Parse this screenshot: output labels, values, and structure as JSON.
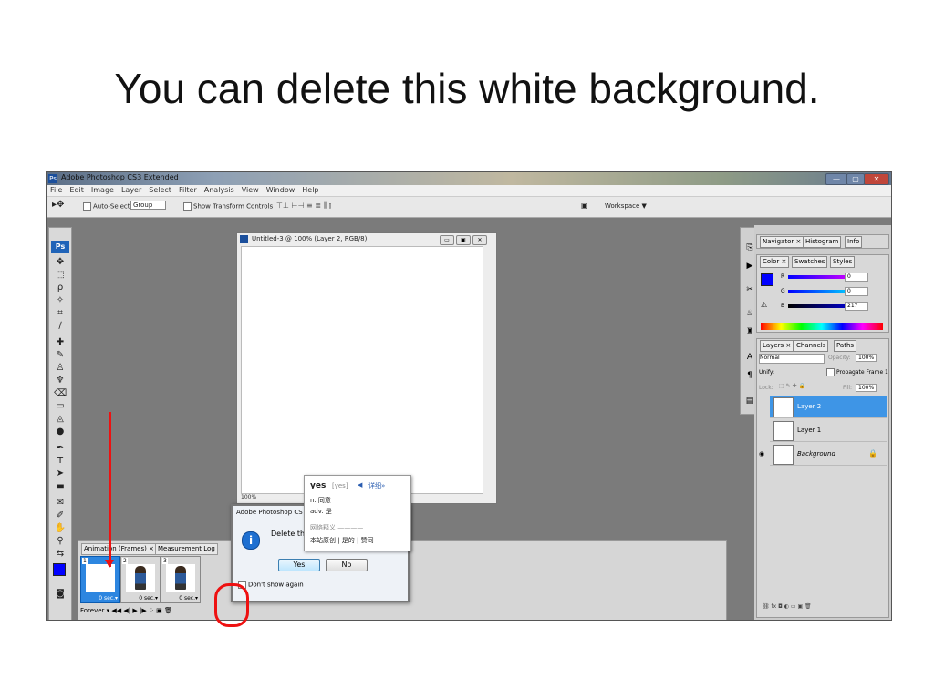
{
  "slide": {
    "title": "You can delete this white background."
  },
  "window": {
    "app_title": "Adobe Photoshop CS3 Extended",
    "app_icon": "Ps",
    "buttons": [
      "—",
      "▢",
      "✕"
    ]
  },
  "menu": [
    "File",
    "Edit",
    "Image",
    "Layer",
    "Select",
    "Filter",
    "Analysis",
    "View",
    "Window",
    "Help"
  ],
  "options": {
    "auto_select": "Auto-Select:",
    "group_value": "Group",
    "show_transform": "Show Transform Controls",
    "workspace": "Workspace ▼"
  },
  "toolbox": {
    "logo": "Ps"
  },
  "document": {
    "title": "Untitled-3 @ 100% (Layer 2, RGB/8)",
    "zoom": "100%"
  },
  "animation": {
    "tabs": [
      "Animation (Frames) ×",
      "Measurement Log"
    ],
    "frames": [
      {
        "num": "1",
        "delay": "0 sec.▾"
      },
      {
        "num": "2",
        "delay": "0 sec.▾"
      },
      {
        "num": "3",
        "delay": "0 sec.▾"
      }
    ],
    "loop": "Forever ▾"
  },
  "dialog": {
    "title": "Adobe Photoshop CS",
    "message": "Delete the",
    "yes": "Yes",
    "no": "No",
    "dont_show": "Don't show again"
  },
  "tooltip": {
    "word": "yes",
    "phonetic": "[yes]",
    "more": "详细»",
    "def1": "n. 同意",
    "def2": "adv. 是",
    "section": "网络释义 ————",
    "links": "本站原创 | 是的 | 赞同"
  },
  "panels": {
    "nav_tabs": [
      "Navigator ×",
      "Histogram",
      "Info"
    ],
    "color_tabs": [
      "Color ×",
      "Swatches",
      "Styles"
    ],
    "color_values": [
      {
        "ch": "R",
        "val": "0"
      },
      {
        "ch": "G",
        "val": "0"
      },
      {
        "ch": "B",
        "val": "217"
      }
    ],
    "layers_tabs": [
      "Layers ×",
      "Channels",
      "Paths"
    ],
    "blend_mode": "Normal",
    "opacity_label": "Opacity:",
    "opacity": "100%",
    "unify": "Unify:",
    "propagate": "Propagate Frame 1",
    "lock": "Lock:",
    "fill_label": "Fill:",
    "fill": "100%",
    "layers": [
      {
        "name": "Layer 2"
      },
      {
        "name": "Layer 1"
      },
      {
        "name": "Background"
      }
    ]
  },
  "colors": {
    "accent": "#3e95e6",
    "foreground": "#0000ff",
    "annotation": "#e11111"
  }
}
